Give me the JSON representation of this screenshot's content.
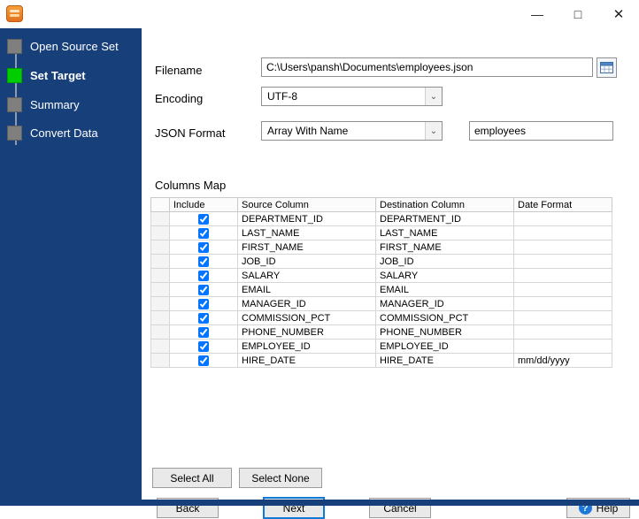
{
  "window": {
    "controls": {
      "minimize": "—",
      "maximize": "□",
      "close": "✕"
    }
  },
  "colors": {
    "sidebar_navy": "#17407b",
    "active_step_green": "#00cc00",
    "inactive_step_gray": "#7f7f7f",
    "focus_border_blue": "#0f7ad8",
    "help_icon_blue": "#1e78d7",
    "app_icon_orange": "#e2701d"
  },
  "sidebar": {
    "steps": [
      {
        "label": "Open Source Set",
        "active": false
      },
      {
        "label": "Set Target",
        "active": true
      },
      {
        "label": "Summary",
        "active": false
      },
      {
        "label": "Convert Data",
        "active": false
      }
    ]
  },
  "form": {
    "filename_label": "Filename",
    "filename_value": "C:\\Users\\pansh\\Documents\\employees.json",
    "encoding_label": "Encoding",
    "encoding_value": "UTF-8",
    "json_format_label": "JSON Format",
    "json_format_value": "Array With Name",
    "array_name_value": "employees",
    "dropdown_arrow": "⌄"
  },
  "columns_map": {
    "title": "Columns Map",
    "headers": [
      "",
      "Include",
      "Source Column",
      "Destination Column",
      "Date Format"
    ],
    "rows": [
      {
        "include": true,
        "source": "DEPARTMENT_ID",
        "destination": "DEPARTMENT_ID",
        "date_format": ""
      },
      {
        "include": true,
        "source": "LAST_NAME",
        "destination": "LAST_NAME",
        "date_format": ""
      },
      {
        "include": true,
        "source": "FIRST_NAME",
        "destination": "FIRST_NAME",
        "date_format": ""
      },
      {
        "include": true,
        "source": "JOB_ID",
        "destination": "JOB_ID",
        "date_format": ""
      },
      {
        "include": true,
        "source": "SALARY",
        "destination": "SALARY",
        "date_format": ""
      },
      {
        "include": true,
        "source": "EMAIL",
        "destination": "EMAIL",
        "date_format": ""
      },
      {
        "include": true,
        "source": "MANAGER_ID",
        "destination": "MANAGER_ID",
        "date_format": ""
      },
      {
        "include": true,
        "source": "COMMISSION_PCT",
        "destination": "COMMISSION_PCT",
        "date_format": ""
      },
      {
        "include": true,
        "source": "PHONE_NUMBER",
        "destination": "PHONE_NUMBER",
        "date_format": ""
      },
      {
        "include": true,
        "source": "EMPLOYEE_ID",
        "destination": "EMPLOYEE_ID",
        "date_format": ""
      },
      {
        "include": true,
        "source": "HIRE_DATE",
        "destination": "HIRE_DATE",
        "date_format": "mm/dd/yyyy"
      }
    ]
  },
  "buttons": {
    "select_all": "Select All",
    "select_none": "Select None",
    "back": "Back",
    "next": "Next",
    "cancel": "Cancel",
    "help": "Help",
    "help_icon_glyph": "?"
  }
}
